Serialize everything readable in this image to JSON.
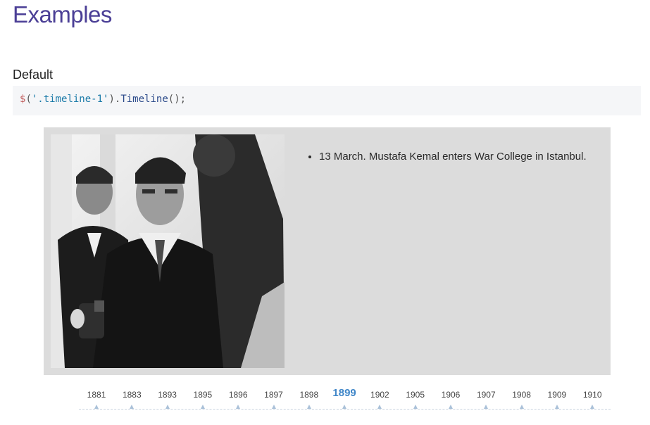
{
  "page": {
    "title": "Examples",
    "title_color": "#4b3f96"
  },
  "section": {
    "title": "Default"
  },
  "code": {
    "dollar": "$",
    "open_paren": "(",
    "selector": "'.timeline-1'",
    "close_paren": ")",
    "dot": ".",
    "method": "Timeline",
    "call": "();"
  },
  "timeline": {
    "image_subject": "historical-photo",
    "items": [
      "13 March. Mustafa Kemal enters War College in Istanbul."
    ],
    "dates": [
      "1881",
      "1883",
      "1893",
      "1895",
      "1896",
      "1897",
      "1898",
      "1899",
      "1902",
      "1905",
      "1906",
      "1907",
      "1908",
      "1909",
      "1910"
    ],
    "active_index": 7,
    "active_color": "#3f86c8"
  }
}
